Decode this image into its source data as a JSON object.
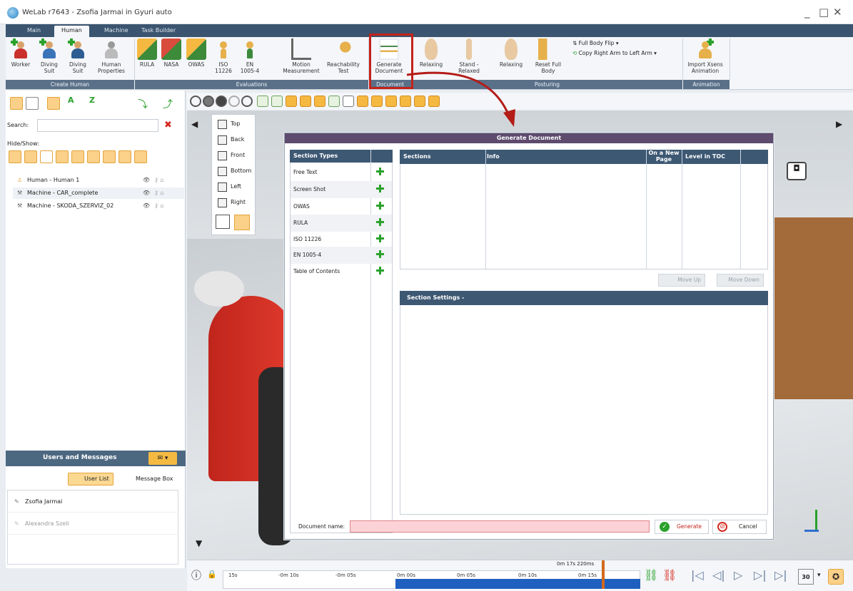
{
  "window": {
    "title": "WeLab r7643 - Zsofia Jarmai in Gyuri auto",
    "controls": [
      "_",
      "□",
      "✕"
    ]
  },
  "ribbon_tabs": [
    {
      "label": "Main",
      "active": false
    },
    {
      "label": "Human",
      "active": true
    },
    {
      "label": "Machine",
      "active": false
    },
    {
      "label": "Task Builder",
      "active": false
    }
  ],
  "ribbon": {
    "create_human": {
      "label": "Create Human",
      "buttons": [
        "Worker",
        "Diving Suit",
        "Diving Suit",
        "Human Properties"
      ]
    },
    "evaluations": {
      "label": "Evaluations",
      "buttons": [
        "RULA",
        "NASA",
        "OWAS",
        "ISO 11226",
        "EN 1005-4",
        "Motion Measurement",
        "Reachability Test"
      ]
    },
    "document": {
      "label": "Document",
      "buttons": [
        "Generate Document"
      ]
    },
    "posturing": {
      "label": "Posturing",
      "buttons": [
        "Relaxing",
        "Stand - Relaxed",
        "Relaxing",
        "Reset Full Body"
      ],
      "full_body_flip": "Full Body Flip",
      "copy_arm": "Copy Right Arm to Left Arm"
    },
    "animation": {
      "label": "Animation",
      "buttons": [
        "Import Xsens Animation"
      ]
    }
  },
  "left_panel": {
    "search_label": "Search:",
    "hide_show_label": "Hide/Show:",
    "tree": [
      {
        "label": "Human - Human 1"
      },
      {
        "label": "Machine - CAR_complete"
      },
      {
        "label": "Machine - SKODA_SZERVIZ_02"
      }
    ],
    "users": {
      "title": "Users and Messages",
      "user_list_label": "User List",
      "message_box_label": "Message Box",
      "list": [
        {
          "name": "Zsofia Jarmai"
        },
        {
          "name": "Alexandra Szeli"
        }
      ]
    }
  },
  "view_cube": [
    "Top",
    "Back",
    "Front",
    "Bottom",
    "Left",
    "Right"
  ],
  "dialog": {
    "title": "Generate Document",
    "section_types_header": "Section Types",
    "section_types": [
      "Free Text",
      "Screen Shot",
      "OWAS",
      "RULA",
      "ISO 11226",
      "EN 1005-4",
      "Table of Contents"
    ],
    "sections_columns": [
      "Sections",
      "Info",
      "On a New Page",
      "Level in TOC"
    ],
    "move_up": "Move Up",
    "move_down": "Move Down",
    "section_settings": "Section Settings -",
    "document_name_label": "Document name:",
    "document_name_value": "",
    "generate": "Generate",
    "cancel": "Cancel"
  },
  "timeline": {
    "ticks": [
      "15s",
      "-0m 10s",
      "-0m 05s",
      "0m 00s",
      "0m 05s",
      "0m 10s",
      "0m 15s"
    ],
    "current_time": "0m 17s 220ms"
  },
  "colors": {
    "ribbon_tab_bg": "#3b5570",
    "header_bg": "#3d5873",
    "dialog_title_bg": "#5e4b6e",
    "highlight_red": "#c4231b",
    "accent_orange": "#f5b942"
  }
}
